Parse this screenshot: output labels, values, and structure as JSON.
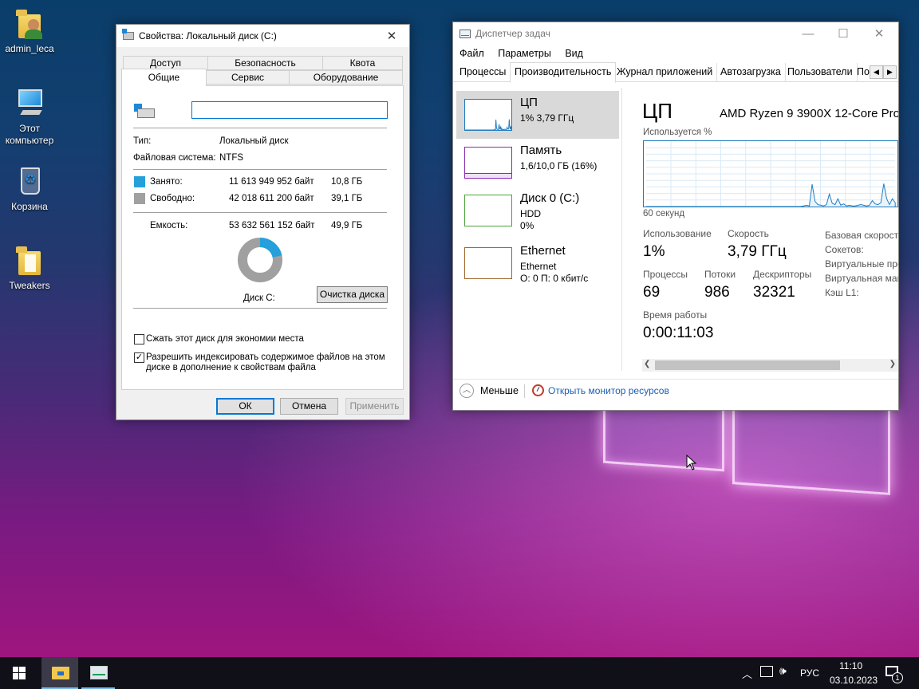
{
  "desktop": {
    "icons": [
      {
        "label": "admin_leca",
        "icon": "user-folder-icon"
      },
      {
        "label": "Этот компьютер",
        "icon": "computer-icon"
      },
      {
        "label": "Корзина",
        "icon": "recycle-bin-icon"
      },
      {
        "label": "Tweakers",
        "icon": "folder-icon"
      }
    ]
  },
  "props": {
    "title": "Свойства: Локальный диск (C:)",
    "tabs_top": [
      "Доступ",
      "Безопасность",
      "Квота"
    ],
    "tabs_bottom": [
      "Общие",
      "Сервис",
      "Оборудование"
    ],
    "name_value": "",
    "type_label": "Тип:",
    "type_value": "Локальный диск",
    "fs_label": "Файловая система:",
    "fs_value": "NTFS",
    "used_label": "Занято:",
    "used_bytes": "11 613 949 952 байт",
    "used_size": "10,8 ГБ",
    "free_label": "Свободно:",
    "free_bytes": "42 018 611 200 байт",
    "free_size": "39,1 ГБ",
    "cap_label": "Емкость:",
    "cap_bytes": "53 632 561 152 байт",
    "cap_size": "49,9 ГБ",
    "used_fraction": 0.2166,
    "used_color": "#26a0da",
    "free_color": "#a0a0a0",
    "disk_label": "Диск C:",
    "cleanup_label": "Очистка диска",
    "compress_label": "Сжать этот диск для экономии места",
    "compress_checked": false,
    "index_label_1": "Разрешить индексировать содержимое файлов на этом",
    "index_label_2": "диске в дополнение к свойствам файла",
    "index_checked": true,
    "ok": "ОК",
    "cancel": "Отмена",
    "apply": "Применить"
  },
  "tm": {
    "title": "Диспетчер задач",
    "menu": [
      "Файл",
      "Параметры",
      "Вид"
    ],
    "tabs": [
      "Процессы",
      "Производительность",
      "Журнал приложений",
      "Автозагрузка",
      "Пользователи",
      "По"
    ],
    "side": [
      {
        "title": "ЦП",
        "sub1": "1% 3,79 ГГц",
        "sub2": "",
        "color": "#1d7bc1"
      },
      {
        "title": "Память",
        "sub1": "1,6/10,0 ГБ (16%)",
        "sub2": "",
        "color": "#8b2bb0"
      },
      {
        "title": "Диск 0 (C:)",
        "sub1": "HDD",
        "sub2": "0%",
        "color": "#4da33b"
      },
      {
        "title": "Ethernet",
        "sub1": "Ethernet",
        "sub2": "О: 0 П: 0 кбит/с",
        "color": "#a0662a"
      }
    ],
    "cpu_title": "ЦП",
    "cpu_model": "AMD Ryzen 9 3900X 12-Core Pro",
    "graph_label": "Используется %",
    "graph_time": "60 секунд",
    "usage_label": "Использование",
    "usage_value": "1%",
    "speed_label": "Скорость",
    "speed_value": "3,79 ГГц",
    "proc_label": "Процессы",
    "proc_value": "69",
    "threads_label": "Потоки",
    "threads_value": "986",
    "handles_label": "Дескрипторы",
    "handles_value": "32321",
    "uptime_label": "Время работы",
    "uptime_value": "0:00:11:03",
    "right_labels": [
      "Базовая скорость",
      "Сокетов:",
      "Виртуальные про",
      "Виртуальная маш",
      "Кэш L1:"
    ],
    "less_label": "Меньше",
    "monitor_label": "Открыть монитор ресурсов",
    "cpu_graph": [
      0,
      0,
      0,
      0,
      0,
      0,
      0,
      0,
      0,
      0,
      0,
      0,
      0,
      0,
      0,
      0,
      0,
      0,
      0,
      0,
      0,
      0,
      0,
      0,
      0,
      0,
      0,
      0,
      0,
      0,
      0,
      0,
      0,
      0,
      0,
      0,
      0,
      0,
      0,
      0,
      0,
      0,
      0,
      0,
      0,
      0,
      0,
      0,
      0,
      0,
      0,
      0,
      0,
      0,
      0,
      1,
      2,
      1,
      34,
      8,
      3,
      2,
      1,
      3,
      19,
      5,
      3,
      12,
      2,
      4,
      1,
      2,
      1,
      1,
      2,
      3,
      2,
      1,
      2,
      9,
      4,
      3,
      6,
      35,
      12,
      3,
      12,
      6
    ]
  },
  "taskbar": {
    "lang": "РУС",
    "time": "11:10",
    "date": "03.10.2023",
    "notif_count": "1"
  }
}
